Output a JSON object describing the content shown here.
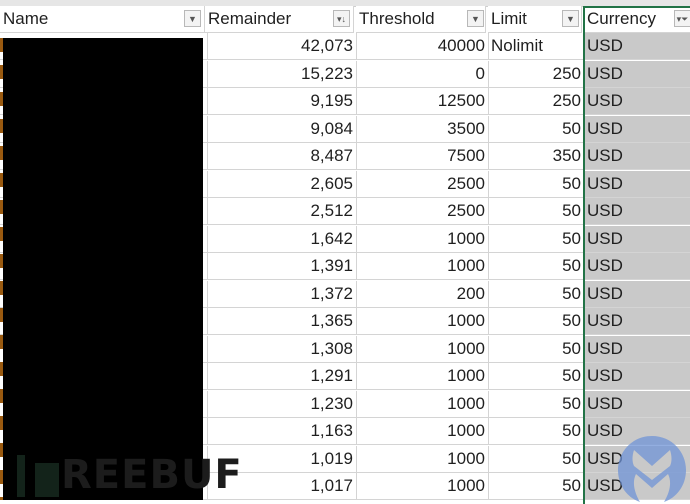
{
  "columns": [
    {
      "key": "name",
      "label": "Name",
      "filter_icon": "dropdown-arrow"
    },
    {
      "key": "remainder",
      "label": "Remainder",
      "filter_icon": "sort-descending"
    },
    {
      "key": "threshold",
      "label": "Threshold",
      "filter_icon": "dropdown-arrow"
    },
    {
      "key": "limit",
      "label": "Limit",
      "filter_icon": "dropdown-arrow"
    },
    {
      "key": "currency",
      "label": "Currency",
      "filter_icon": "filter-funnel"
    }
  ],
  "rows": [
    {
      "name": "[redacted]",
      "remainder": "42,073",
      "threshold": "40000",
      "limit": "Nolimit",
      "currency": "USD"
    },
    {
      "name": "[redacted]",
      "remainder": "15,223",
      "threshold": "0",
      "limit": "250",
      "currency": "USD"
    },
    {
      "name": "[redacted]",
      "remainder": "9,195",
      "threshold": "12500",
      "limit": "250",
      "currency": "USD"
    },
    {
      "name": "[redacted]",
      "remainder": "9,084",
      "threshold": "3500",
      "limit": "50",
      "currency": "USD"
    },
    {
      "name": "[redacted]",
      "remainder": "8,487",
      "threshold": "7500",
      "limit": "350",
      "currency": "USD"
    },
    {
      "name": "[redacted]",
      "remainder": "2,605",
      "threshold": "2500",
      "limit": "50",
      "currency": "USD"
    },
    {
      "name": "[redacted]",
      "remainder": "2,512",
      "threshold": "2500",
      "limit": "50",
      "currency": "USD"
    },
    {
      "name": "[redacted]",
      "remainder": "1,642",
      "threshold": "1000",
      "limit": "50",
      "currency": "USD"
    },
    {
      "name": "[redacted]",
      "remainder": "1,391",
      "threshold": "1000",
      "limit": "50",
      "currency": "USD"
    },
    {
      "name": "[redacted]",
      "remainder": "1,372",
      "threshold": "200",
      "limit": "50",
      "currency": "USD"
    },
    {
      "name": "[redacted]",
      "remainder": "1,365",
      "threshold": "1000",
      "limit": "50",
      "currency": "USD"
    },
    {
      "name": "[redacted]",
      "remainder": "1,308",
      "threshold": "1000",
      "limit": "50",
      "currency": "USD"
    },
    {
      "name": "[redacted]",
      "remainder": "1,291",
      "threshold": "1000",
      "limit": "50",
      "currency": "USD"
    },
    {
      "name": "[redacted]",
      "remainder": "1,230",
      "threshold": "1000",
      "limit": "50",
      "currency": "USD"
    },
    {
      "name": "[redacted]",
      "remainder": "1,163",
      "threshold": "1000",
      "limit": "50",
      "currency": "USD"
    },
    {
      "name": "[redacted]",
      "remainder": "1,019",
      "threshold": "1000",
      "limit": "50",
      "currency": "USD"
    },
    {
      "name": "[redacted]",
      "remainder": "1,017",
      "threshold": "1000",
      "limit": "50",
      "currency": "USD"
    }
  ],
  "selection": {
    "selected_column": "Currency",
    "color": "#217346"
  },
  "colors": {
    "selected_column_fill": "#c9c9c9",
    "gridline": "#d4d4d4",
    "redaction": "#000000"
  },
  "watermarks": {
    "left": "FREEBUF",
    "right": "malwarebytes-logo"
  }
}
